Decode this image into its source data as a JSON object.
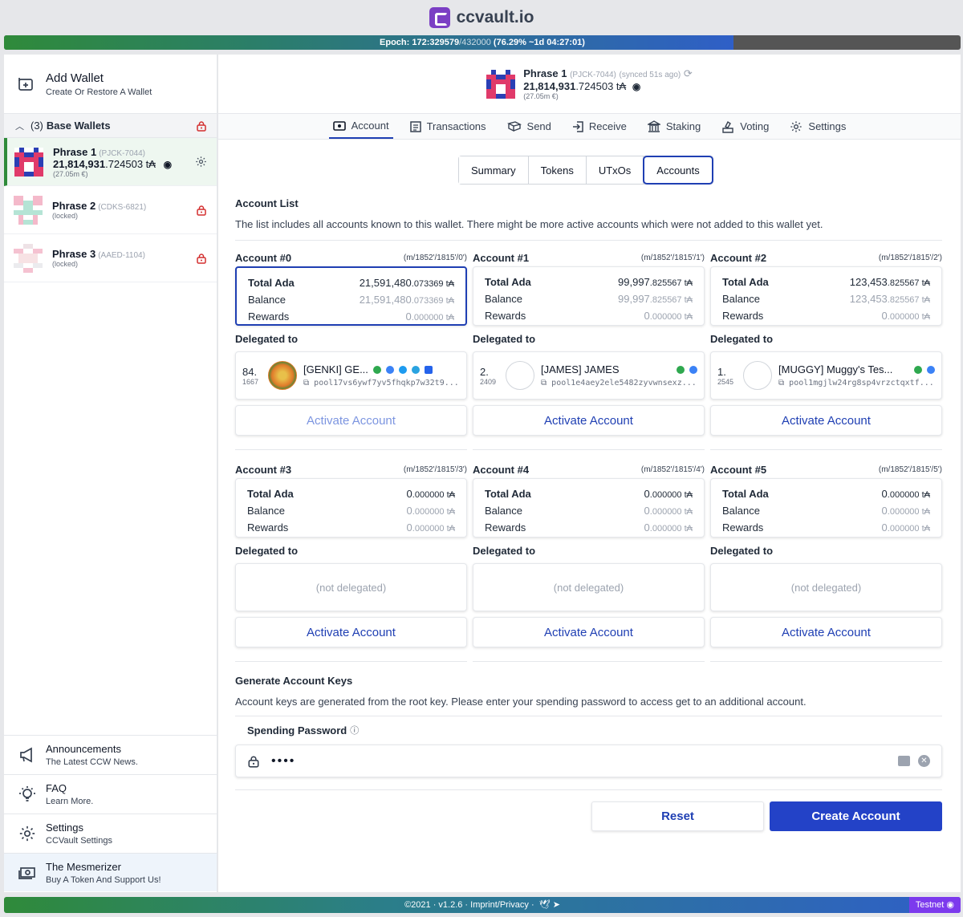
{
  "brand": {
    "name": "ccvault.io"
  },
  "epoch": {
    "text_main": "Epoch: 172:329579",
    "text_total": "/432000",
    "text_tail": "(76.29% ~1d 04:27:01)",
    "progress": 0.7629
  },
  "sidebar": {
    "add_wallet": {
      "title": "Add Wallet",
      "subtitle": "Create Or Restore A Wallet"
    },
    "group": {
      "count": "(3)",
      "label": "Base Wallets"
    },
    "wallets": [
      {
        "name": "Phrase 1",
        "id": "(PJCK-7044)",
        "balance_int": "21,814,931",
        "balance_dec": ".724503 t₳",
        "fiat": "(27.05m €)",
        "status": ""
      },
      {
        "name": "Phrase 2",
        "id": "(CDKS-6821)",
        "status": "(locked)"
      },
      {
        "name": "Phrase 3",
        "id": "(AAED-1104)",
        "status": "(locked)"
      }
    ],
    "bottom": [
      {
        "title": "Announcements",
        "subtitle": "The Latest CCW News.",
        "icon": "megaphone-icon"
      },
      {
        "title": "FAQ",
        "subtitle": "Learn More.",
        "icon": "lightbulb-icon"
      },
      {
        "title": "Settings",
        "subtitle": "CCVault Settings",
        "icon": "gear-icon"
      },
      {
        "title": "The Mesmerizer",
        "subtitle": "Buy A Token And Support Us!",
        "icon": "money-icon"
      }
    ]
  },
  "header": {
    "wallet_name": "Phrase 1",
    "wallet_id": "(PJCK-7044)",
    "synced": "(synced 51s ago)",
    "balance_int": "21,814,931",
    "balance_dec": ".724503 t₳",
    "fiat": "(27.05m €)"
  },
  "nav": [
    {
      "label": "Account",
      "icon": "wallet-icon",
      "active": true
    },
    {
      "label": "Transactions",
      "icon": "list-icon"
    },
    {
      "label": "Send",
      "icon": "send-icon"
    },
    {
      "label": "Receive",
      "icon": "receive-icon"
    },
    {
      "label": "Staking",
      "icon": "bank-icon"
    },
    {
      "label": "Voting",
      "icon": "voting-icon"
    },
    {
      "label": "Settings",
      "icon": "gear-icon"
    }
  ],
  "tabs": [
    {
      "label": "Summary"
    },
    {
      "label": "Tokens"
    },
    {
      "label": "UTxOs"
    },
    {
      "label": "Accounts",
      "active": true
    }
  ],
  "account_list": {
    "title": "Account List",
    "description": "The list includes all accounts known to this wallet. There might be more active accounts which were not added to this wallet yet."
  },
  "labels": {
    "total": "Total Ada",
    "balance": "Balance",
    "rewards": "Rewards",
    "delegated_to": "Delegated to",
    "activate": "Activate Account",
    "not_delegated": "(not delegated)"
  },
  "accounts": [
    {
      "name": "Account #0",
      "path": "(m/1852'/1815'/0')",
      "total_int": "21,591,480",
      "total_dec": ".073369 t₳",
      "balance_int": "21,591,480",
      "balance_dec": ".073369 t₳",
      "rewards_int": "0",
      "rewards_dec": ".000000 t₳",
      "pool": {
        "rank": "84.",
        "rank_sub": "1667",
        "name": "[GENKI] GE...",
        "id": "pool17vs6ywf7yv5fhqkp7w32t9..."
      }
    },
    {
      "name": "Account #1",
      "path": "(m/1852'/1815'/1')",
      "total_int": "99,997",
      "total_dec": ".825567 t₳",
      "balance_int": "99,997",
      "balance_dec": ".825567 t₳",
      "rewards_int": "0",
      "rewards_dec": ".000000 t₳",
      "pool": {
        "rank": "2.",
        "rank_sub": "2409",
        "name": "[JAMES] JAMES",
        "id": "pool1e4aey2ele5482zyvwnsexz..."
      }
    },
    {
      "name": "Account #2",
      "path": "(m/1852'/1815'/2')",
      "total_int": "123,453",
      "total_dec": ".825567 t₳",
      "balance_int": "123,453",
      "balance_dec": ".825567 t₳",
      "rewards_int": "0",
      "rewards_dec": ".000000 t₳",
      "pool": {
        "rank": "1.",
        "rank_sub": "2545",
        "name": "[MUGGY] Muggy's Tes...",
        "id": "pool1mgjlw24rg8sp4vrzctqxtf..."
      }
    },
    {
      "name": "Account #3",
      "path": "(m/1852'/1815'/3')",
      "total_int": "0",
      "total_dec": ".000000 t₳",
      "balance_int": "0",
      "balance_dec": ".000000 t₳",
      "rewards_int": "0",
      "rewards_dec": ".000000 t₳"
    },
    {
      "name": "Account #4",
      "path": "(m/1852'/1815'/4')",
      "total_int": "0",
      "total_dec": ".000000 t₳",
      "balance_int": "0",
      "balance_dec": ".000000 t₳",
      "rewards_int": "0",
      "rewards_dec": ".000000 t₳"
    },
    {
      "name": "Account #5",
      "path": "(m/1852'/1815'/5')",
      "total_int": "0",
      "total_dec": ".000000 t₳",
      "balance_int": "0",
      "balance_dec": ".000000 t₳",
      "rewards_int": "0",
      "rewards_dec": ".000000 t₳"
    }
  ],
  "generate": {
    "title": "Generate Account Keys",
    "description": "Account keys are generated from the root key. Please enter your spending password to access get to an additional account.",
    "password_label": "Spending Password",
    "password_value": "••••",
    "reset_label": "Reset",
    "create_label": "Create Account"
  },
  "footer": {
    "text": "©2021 · v1.2.6 · Imprint/Privacy ·",
    "network": "Testnet"
  },
  "colors": {
    "accent": "#1f3fb3",
    "green": "#2f8a3a",
    "purple": "#7b3fc4",
    "lock": "#d32f2f"
  }
}
